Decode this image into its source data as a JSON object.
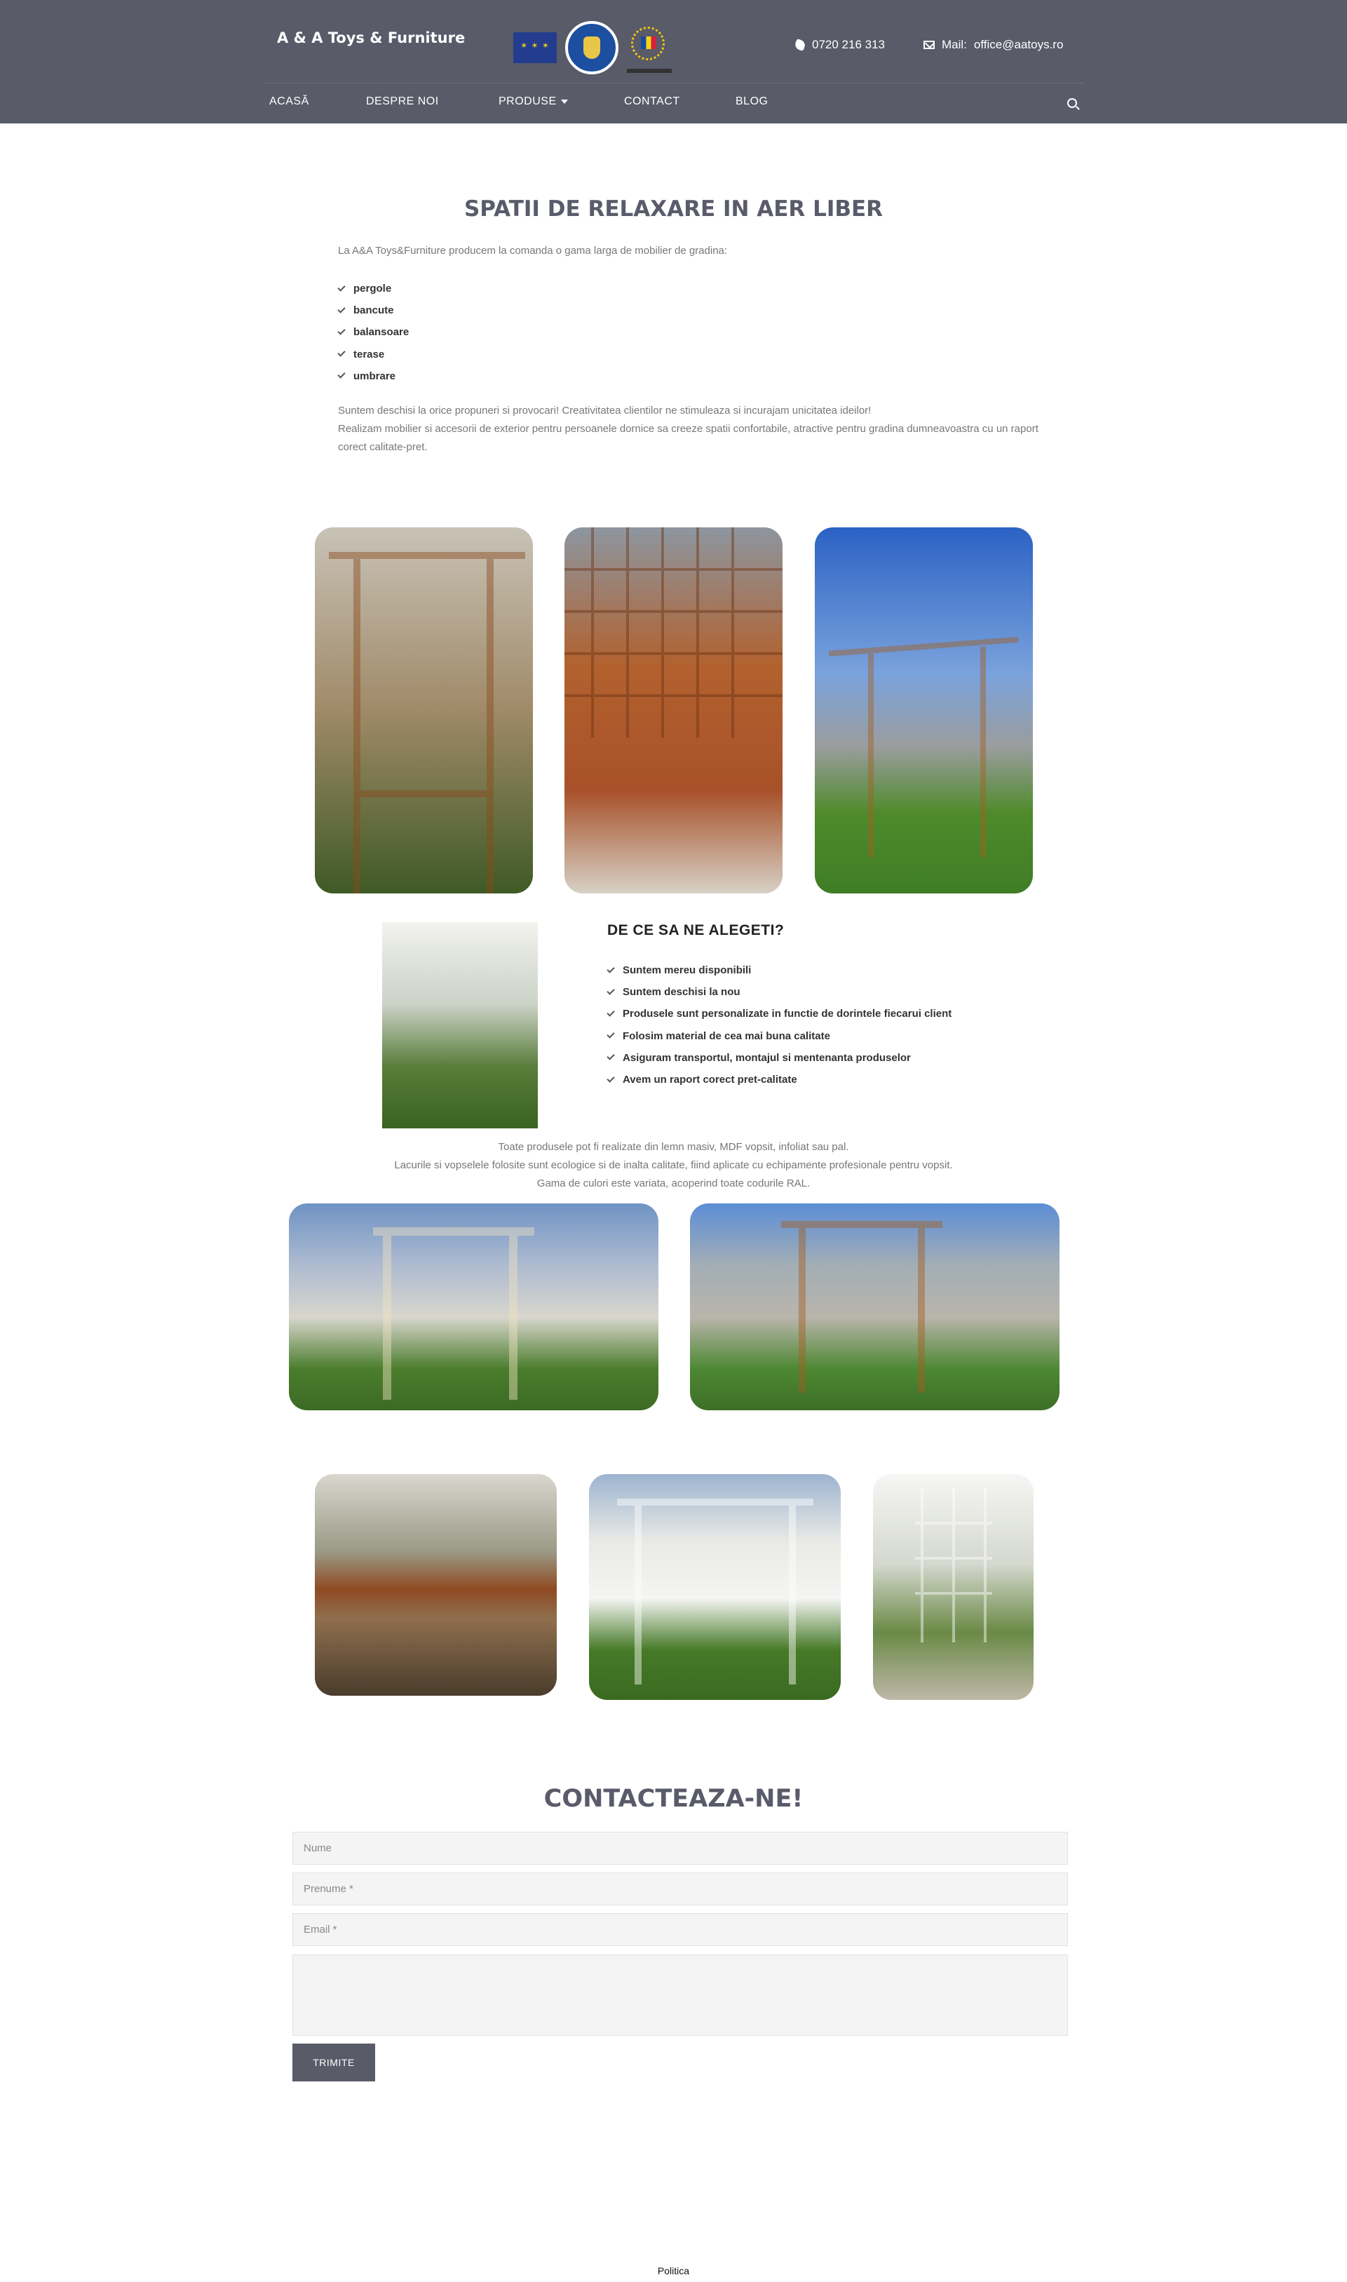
{
  "header": {
    "brand": "A & A Toys & Furniture",
    "phone": "0720 216 313",
    "mail_label": "Mail:",
    "mail": "office@aatoys.ro"
  },
  "nav": {
    "items": [
      "ACASĂ",
      "DESPRE NOI",
      "PRODUSE",
      "CONTACT",
      "BLOG"
    ]
  },
  "intro": {
    "title": "SPATII DE RELAXARE IN AER LIBER",
    "lead": "La A&A Toys&Furniture producem la comanda o gama larga de mobilier de gradina:",
    "products": [
      "pergole",
      "bancute",
      "balansoare",
      "terase",
      "umbrare"
    ],
    "para1": "Suntem deschisi la orice propuneri si provocari! Creativitatea clientilor ne stimuleaza si incurajam unicitatea ideilor!",
    "para2": "Realizam mobilier si accesorii de exterior pentru persoanele dornice sa creeze spatii confortabile, atractive pentru gradina dumneavoastra cu un raport corect calitate-pret."
  },
  "why": {
    "title": "DE CE SA NE ALEGETI?",
    "reasons": [
      "Suntem mereu disponibili",
      "Suntem deschisi la nou",
      "Produsele sunt personalizate in functie de dorintele fiecarui client",
      "Folosim material de cea mai buna calitate",
      "Asiguram transportul, montajul si mentenanta produselor",
      "Avem un raport corect pret-calitate"
    ]
  },
  "finish": {
    "line1": "Toate produsele pot fi realizate din lemn masiv, MDF vopsit, infoliat sau pal.",
    "line2": "Lacurile si vopselele folosite sunt ecologice si de inalta calitate, fiind aplicate cu echipamente profesionale pentru vopsit.",
    "line3": "Gama de culori este variata, acoperind toate codurile RAL."
  },
  "contact": {
    "title": "CONTACTEAZA-NE!",
    "name_placeholder": "Nume",
    "prenume_placeholder": "Prenume *",
    "email_placeholder": "Email *",
    "submit": "TRIMITE"
  },
  "footer": {
    "link": "Politica"
  }
}
